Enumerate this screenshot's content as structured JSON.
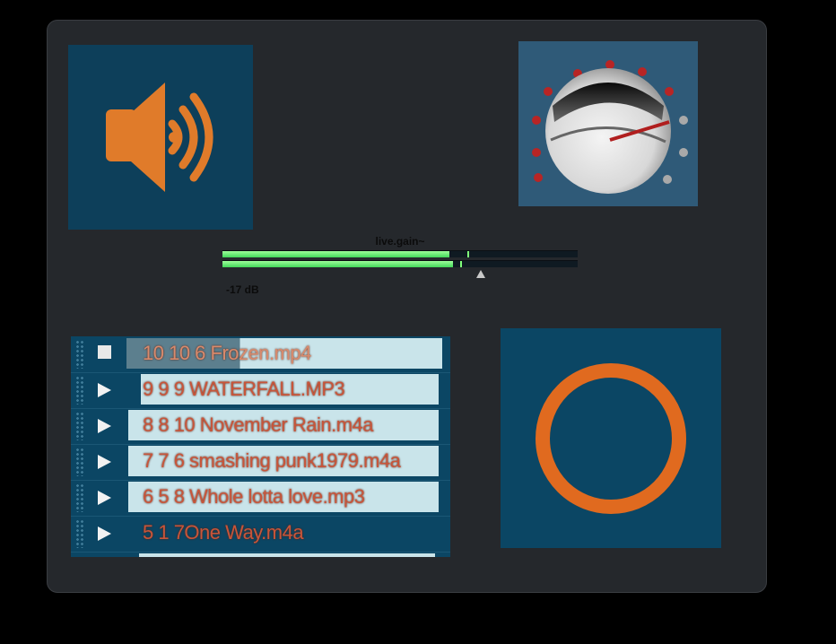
{
  "speaker": {
    "icon": "speaker-volume-icon",
    "color": "#e07b2a",
    "bg": "#0d3f5a"
  },
  "knob": {
    "icon": "rotary-knob-icon"
  },
  "gain": {
    "title": "live.gain~",
    "db_label": "-17 dB",
    "level_top": 0.64,
    "level_bottom": 0.65
  },
  "playlist": {
    "items": [
      {
        "label": "10 10 6 Frozen.mp4",
        "state": "stop"
      },
      {
        "label": "9 9 9 WATERFALL.MP3",
        "state": "play"
      },
      {
        "label": "8 8 10 November Rain.m4a",
        "state": "play"
      },
      {
        "label": "7 7 6 smashing punk1979.m4a",
        "state": "play"
      },
      {
        "label": "6 5 8 Whole lotta love.mp3",
        "state": "play"
      },
      {
        "label": "5 1 7One Way.m4a",
        "state": "play"
      }
    ]
  },
  "dial": {
    "icon": "ring-dial-icon",
    "color": "#e06a1f"
  }
}
